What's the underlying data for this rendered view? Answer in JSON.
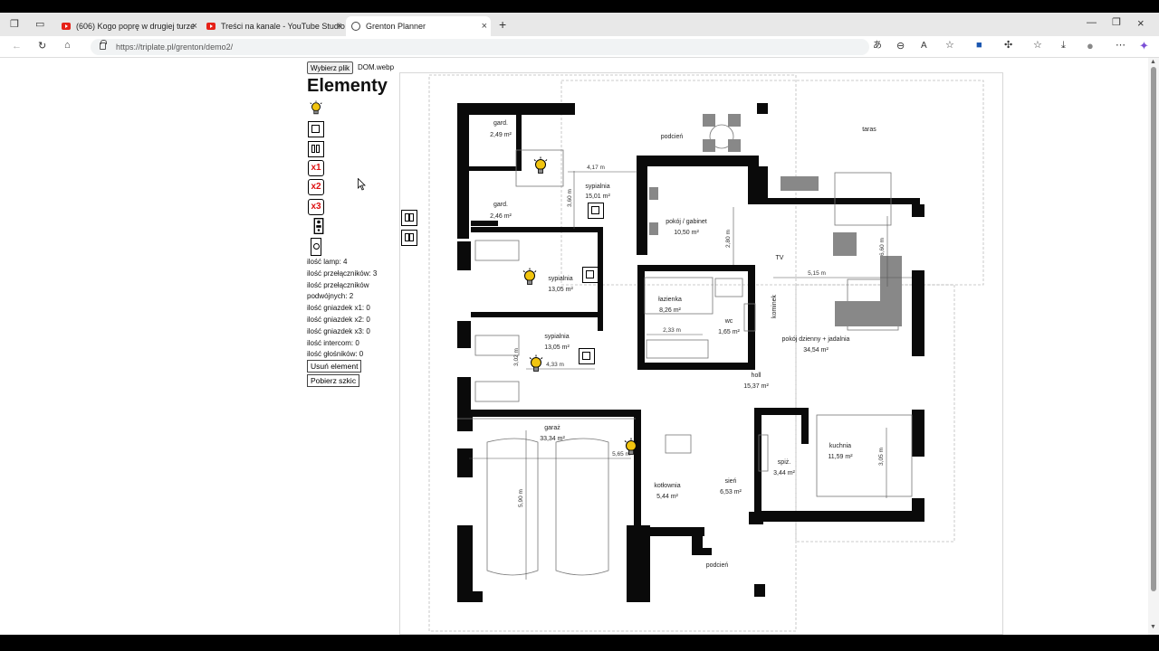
{
  "browser": {
    "tabs": [
      {
        "label": "(606) Kogo poprę w drugiej turze",
        "icon": "youtube-icon"
      },
      {
        "label": "Treści na kanale - YouTube Studio",
        "icon": "youtube-icon"
      },
      {
        "label": "Grenton Planner",
        "icon": "globe-icon",
        "active": true
      }
    ],
    "url": "https://triplate.pl/grenton/demo2/"
  },
  "panel": {
    "file_button": "Wybierz plik",
    "file_name": "DOM.webp",
    "title": "Elementy",
    "tools": [
      {
        "type": "lamp",
        "icon": "lamp-icon"
      },
      {
        "type": "switch",
        "icon": "single-switch-icon"
      },
      {
        "type": "double-switch",
        "icon": "double-switch-icon"
      },
      {
        "type": "socket-x1",
        "label": "x1"
      },
      {
        "type": "socket-x2",
        "label": "x2"
      },
      {
        "type": "socket-x3",
        "label": "x3"
      },
      {
        "type": "intercom",
        "icon": "intercom-icon"
      },
      {
        "type": "speaker",
        "icon": "speaker-icon"
      }
    ],
    "stats": {
      "lamps": "ilość lamp: 4",
      "switches": "ilość przełączników: 3",
      "double_switches": "ilość przełączników podwójnych: 2",
      "sockets_x1": "ilość gniazdek x1: 0",
      "sockets_x2": "ilość gniazdek x2: 0",
      "sockets_x3": "ilość gniazdek x3: 0",
      "intercom": "ilość intercom: 0",
      "speakers": "ilość głośników: 0"
    },
    "remove_button": "Usuń element",
    "download_button": "Pobierz szkic"
  },
  "plan": {
    "rooms": [
      {
        "name": "gard.",
        "area": "2,49 m²"
      },
      {
        "name": "gard.",
        "area": "2,46 m²"
      },
      {
        "name": "sypialnia",
        "area": "15,01 m²"
      },
      {
        "name": "podcień",
        "area": ""
      },
      {
        "name": "taras",
        "area": ""
      },
      {
        "name": "pokój / gabinet",
        "area": "10,50 m²"
      },
      {
        "name": "sypialnia",
        "area": "13,05 m²"
      },
      {
        "name": "łazienka",
        "area": "8,26 m²"
      },
      {
        "name": "wc",
        "area": "1,65 m²"
      },
      {
        "name": "sypialnia",
        "area": "13,05 m²"
      },
      {
        "name": "pokój dzienny + jadalnia",
        "area": "34,54 m²"
      },
      {
        "name": "holl",
        "area": "15,37 m²"
      },
      {
        "name": "garaż",
        "area": "33,34 m²"
      },
      {
        "name": "kotłownia",
        "area": "5,44 m²"
      },
      {
        "name": "sień",
        "area": "6,53 m²"
      },
      {
        "name": "spiż.",
        "area": "3,44 m²"
      },
      {
        "name": "kuchnia",
        "area": "11,59 m²"
      },
      {
        "name": "podcień",
        "area": ""
      }
    ],
    "labels": {
      "tv": "TV",
      "kominek": "kominek"
    },
    "dimensions": [
      "4,17 m",
      "3,60 m",
      "2,80 m",
      "6,60 m",
      "5,15 m",
      "2,33 m",
      "4,33 m",
      "3,02 m",
      "5,65 m",
      "5,90 m",
      "3,05 m"
    ],
    "placed": {
      "lamps": 4,
      "switches": 3,
      "double_switches": 1
    }
  },
  "colors": {
    "wall": "#0a0a0a",
    "furniture": "#999999",
    "plan_line": "#555555",
    "lamp": "#f1c40f",
    "socket_label": "#dd1111"
  }
}
